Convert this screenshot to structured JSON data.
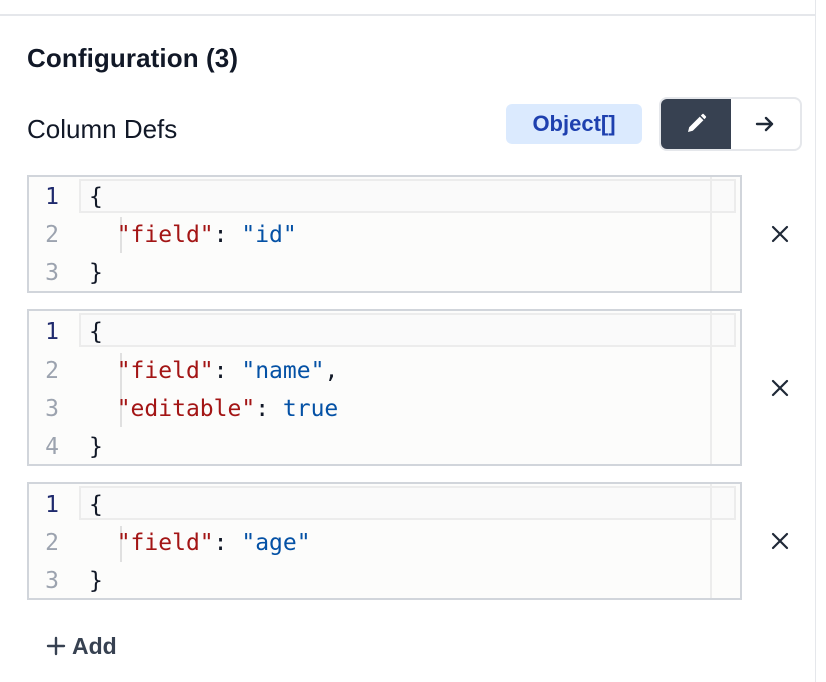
{
  "section": {
    "title": "Configuration (3)"
  },
  "field": {
    "label": "Column Defs",
    "type_badge": "Object[]",
    "mode_toggle": {
      "edit_icon": "pencil-icon",
      "link_icon": "arrow-right-icon"
    }
  },
  "items": [
    {
      "lines": [
        {
          "n": "1",
          "brace": "{"
        },
        {
          "n": "2",
          "key": "\"field\"",
          "colon": ": ",
          "value": "\"id\"",
          "value_type": "string",
          "trail": ""
        },
        {
          "n": "3",
          "brace": "}"
        }
      ],
      "remove_icon": "close-icon"
    },
    {
      "lines": [
        {
          "n": "1",
          "brace": "{"
        },
        {
          "n": "2",
          "key": "\"field\"",
          "colon": ": ",
          "value": "\"name\"",
          "value_type": "string",
          "trail": ","
        },
        {
          "n": "3",
          "key": "\"editable\"",
          "colon": ": ",
          "value": "true",
          "value_type": "boolean",
          "trail": ""
        },
        {
          "n": "4",
          "brace": "}"
        }
      ],
      "remove_icon": "close-icon"
    },
    {
      "lines": [
        {
          "n": "1",
          "brace": "{"
        },
        {
          "n": "2",
          "key": "\"field\"",
          "colon": ": ",
          "value": "\"age\"",
          "value_type": "string",
          "trail": ""
        },
        {
          "n": "3",
          "brace": "}"
        }
      ],
      "remove_icon": "close-icon"
    }
  ],
  "add_button": {
    "icon": "plus-icon",
    "label": "Add"
  },
  "colors": {
    "accent_badge_bg": "#dbeafe",
    "accent_badge_text": "#1e40af",
    "json_key": "#a31515",
    "json_string": "#0451a5"
  }
}
